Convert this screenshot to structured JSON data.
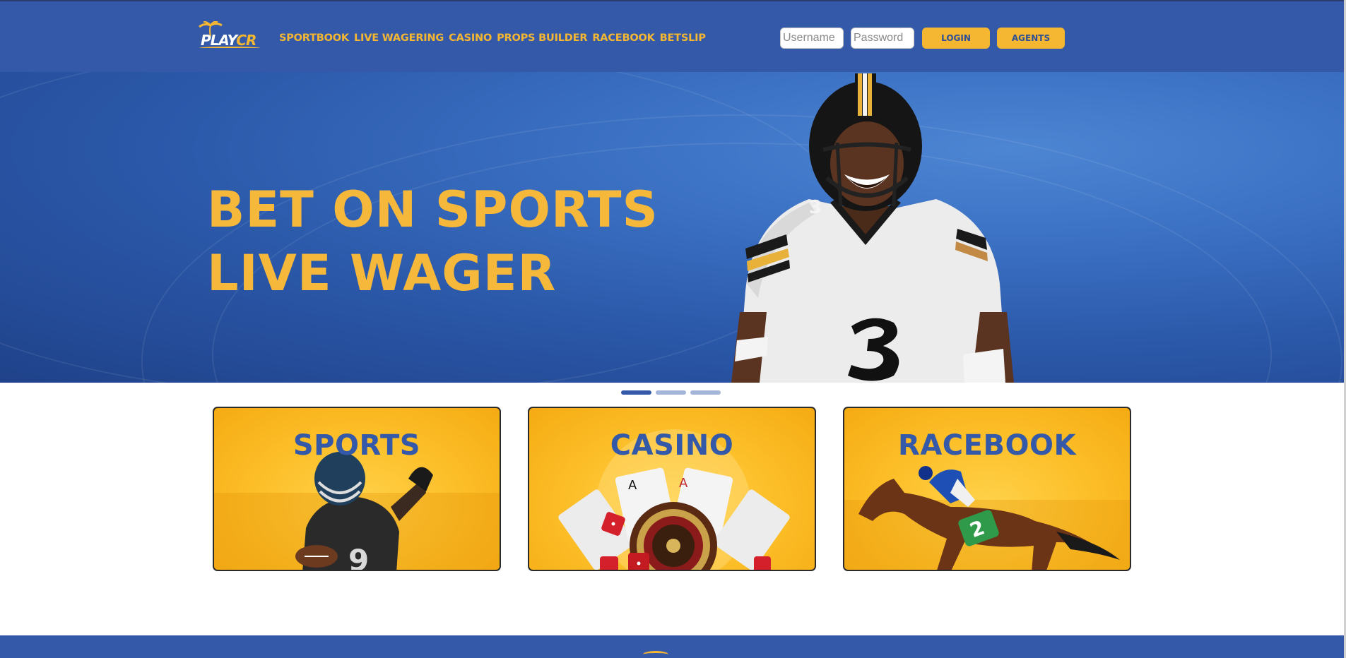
{
  "brand": {
    "logo_main": "PLAY",
    "logo_accent": "CR"
  },
  "nav": [
    "SPORTBOOK",
    "LIVE WAGERING",
    "CASINO",
    "PROPS BUILDER",
    "RACEBOOK",
    "BETSLIP"
  ],
  "login": {
    "username_placeholder": "Username",
    "password_placeholder": "Password",
    "login_label": "LOGIN",
    "agents_label": "AGENTS"
  },
  "hero": {
    "line1": "BET ON SPORTS",
    "line2": "LIVE WAGER",
    "slide_count": 3,
    "active_slide": 1
  },
  "cards": [
    {
      "title": "SPORTS"
    },
    {
      "title": "CASINO"
    },
    {
      "title": "RACEBOOK"
    }
  ],
  "colors": {
    "primary_blue": "#3459a8",
    "accent_gold": "#f5b731",
    "card_gold": "#fcbd26"
  },
  "icons": [
    "palm-tree-logo-icon"
  ]
}
